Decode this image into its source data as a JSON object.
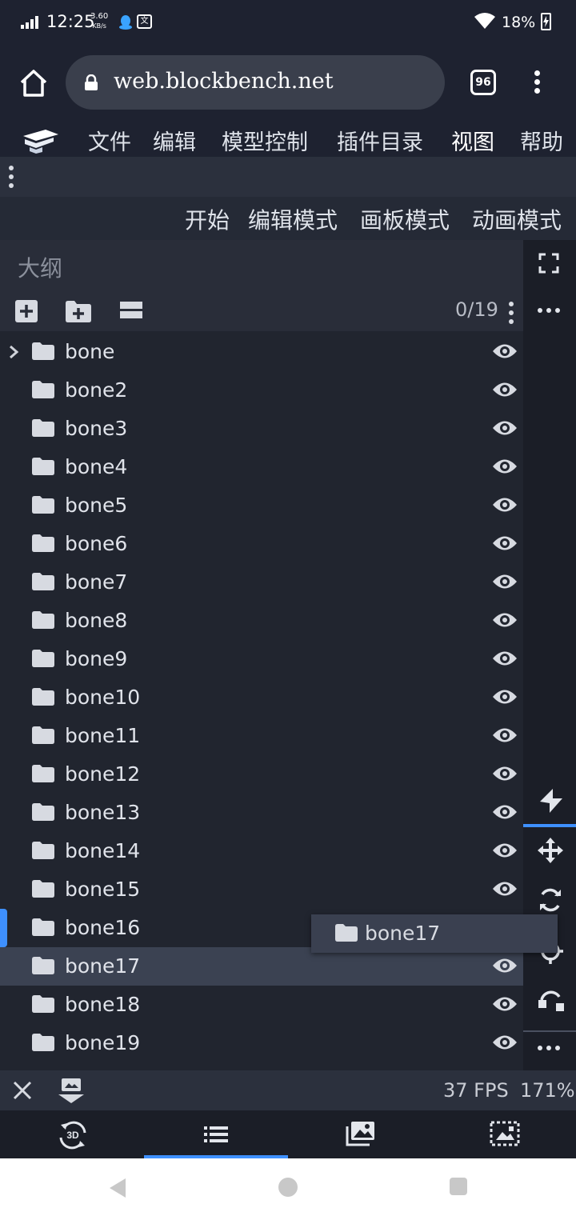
{
  "status_bar": {
    "time": "12:25",
    "speed_value": "3.60",
    "speed_unit": "KB/s",
    "battery": "18%",
    "translate_glyph": "文"
  },
  "browser": {
    "url": "web.blockbench.net",
    "tab_count": "96"
  },
  "menu": {
    "items": [
      "文件",
      "编辑",
      "模型控制",
      "插件目录",
      "视图",
      "帮助"
    ]
  },
  "modes": {
    "tabs": [
      "开始",
      "编辑模式",
      "画板模式",
      "动画模式"
    ],
    "active": "编辑模式"
  },
  "outliner": {
    "title": "大纲",
    "count": "0/19",
    "rows": [
      "bone",
      "bone2",
      "bone3",
      "bone4",
      "bone5",
      "bone6",
      "bone7",
      "bone8",
      "bone9",
      "bone10",
      "bone11",
      "bone12",
      "bone13",
      "bone14",
      "bone15",
      "bone16",
      "bone17",
      "bone18",
      "bone19"
    ],
    "selected": "bone17",
    "dragging": "bone17"
  },
  "footer": {
    "fps": "37 FPS",
    "zoom": "171%"
  },
  "bottom_tabs": {
    "tab_3d_label": "3D",
    "active": "outliner"
  },
  "colors": {
    "accent": "#3e90ff",
    "background": "#1e2230",
    "panel": "#21252f",
    "selected_row": "#3b4252"
  },
  "icons": {
    "toolbar": [
      "add-cube-icon",
      "add-group-icon",
      "collapse-all-icon"
    ],
    "right_bar": [
      "fullscreen-icon",
      "more-icon",
      "vertex-snap-icon",
      "move-icon",
      "rotate-icon",
      "pivot-icon",
      "transform-icon",
      "more-icon"
    ],
    "bottom_tabs": [
      "view-3d-icon",
      "outliner-list-icon",
      "textures-icon",
      "uv-editor-icon"
    ]
  }
}
